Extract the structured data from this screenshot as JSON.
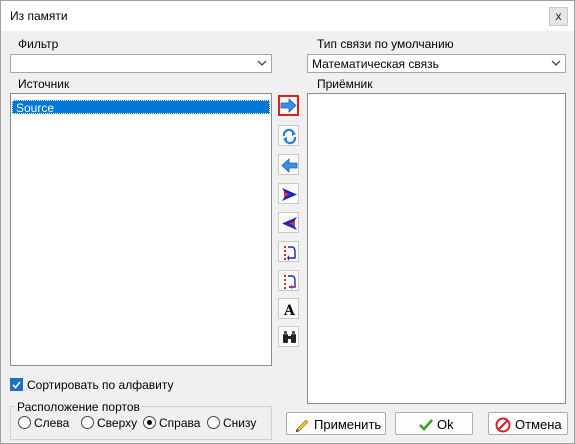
{
  "window": {
    "title": "Из памяти",
    "close_glyph": "x"
  },
  "filter": {
    "label": "Фильтр",
    "value": ""
  },
  "link_type": {
    "label": "Тип связи по умолчанию",
    "value": "Математическая связь"
  },
  "source": {
    "label": "Источник",
    "items": [
      "Source"
    ],
    "selected": "Source"
  },
  "target": {
    "label": "Приёмник",
    "items": []
  },
  "tools": [
    {
      "name": "add-link-icon",
      "active": true
    },
    {
      "name": "refresh-links-icon"
    },
    {
      "name": "remove-link-icon"
    },
    {
      "name": "add-all-links-icon"
    },
    {
      "name": "remove-all-links-icon"
    },
    {
      "name": "port-up-icon"
    },
    {
      "name": "port-down-icon"
    },
    {
      "name": "font-icon"
    },
    {
      "name": "find-icon"
    }
  ],
  "sort": {
    "label": "Сортировать по алфавиту",
    "checked": true
  },
  "ports": {
    "legend": "Расположение портов",
    "options": [
      "Слева",
      "Сверху",
      "Справа",
      "Снизу"
    ],
    "selected": "Справа"
  },
  "buttons": {
    "apply": "Применить",
    "ok": "Ok",
    "cancel": "Отмена"
  },
  "colors": {
    "selection": "#0078d7",
    "active_border": "#e0201a",
    "checkbox": "#1f6fc4"
  }
}
